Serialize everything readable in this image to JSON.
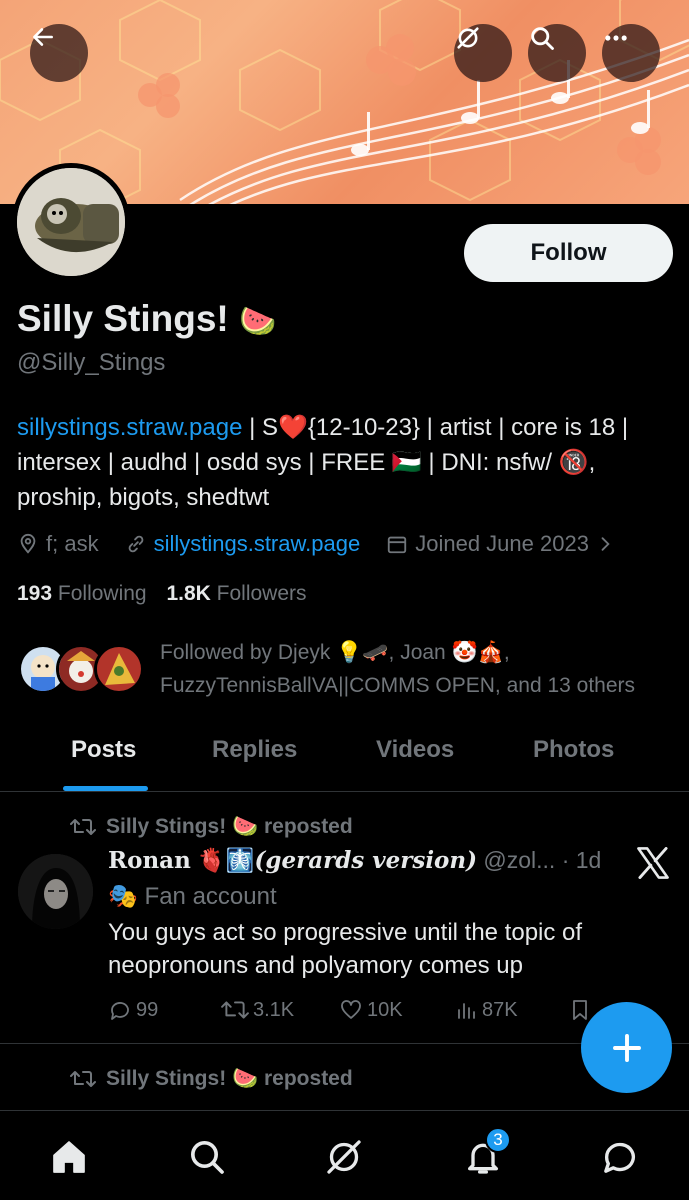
{
  "header": {
    "back_icon": "arrow-left-icon",
    "grok_icon": "grok-icon",
    "search_icon": "search-icon",
    "more_icon": "more-icon"
  },
  "profile": {
    "name": "Silly Stings!",
    "name_emoji": "🍉",
    "handle": "@Silly_Stings",
    "follow_label": "Follow",
    "bio": {
      "link": "sillystings.straw.page",
      "part1": " | S",
      "heart": "❤️",
      "part2": "{12-10-23} | artist | core is 18 | intersex | audhd | osdd sys | FREE ",
      "flag": "🇵🇸",
      "part3": " | DNI: nsfw/ ",
      "no18": "🔞",
      "part4": ", proship, bigots, shedtwt"
    },
    "location": "f; ask",
    "website": "sillystings.straw.page",
    "joined": "Joined June 2023",
    "following_count": "193",
    "following_label": "Following",
    "followers_count": "1.8K",
    "followers_label": "Followers",
    "followed_by": {
      "line1": "Followed by Djeyk 💡🛹, Joan 🤡🎪,",
      "line2": "FuzzyTennisBallVA||COMMS OPEN, and 13 others"
    }
  },
  "tabs": [
    {
      "label": "Posts"
    },
    {
      "label": "Replies"
    },
    {
      "label": "Videos"
    },
    {
      "label": "Photos"
    }
  ],
  "posts": [
    {
      "repost_label": "Silly Stings! 🍉 reposted",
      "author": "Ronan",
      "author_emoji": "🫀🩻",
      "author_suffix": "(gerards version)",
      "handle_time": " @zol... · 1d",
      "fan_label": "🎭 Fan account",
      "text": "You guys act so progressive until the topic of neopronouns and polyamory comes up",
      "replies": "99",
      "reposts": "3.1K",
      "likes": "10K",
      "views": "87K"
    },
    {
      "repost_label": "Silly Stings! 🍉 reposted"
    }
  ],
  "nav": {
    "notification_count": "3"
  },
  "colors": {
    "accent": "#1d9bf0",
    "background": "#000000",
    "muted": "#71767b",
    "text": "#e7e9ea"
  }
}
